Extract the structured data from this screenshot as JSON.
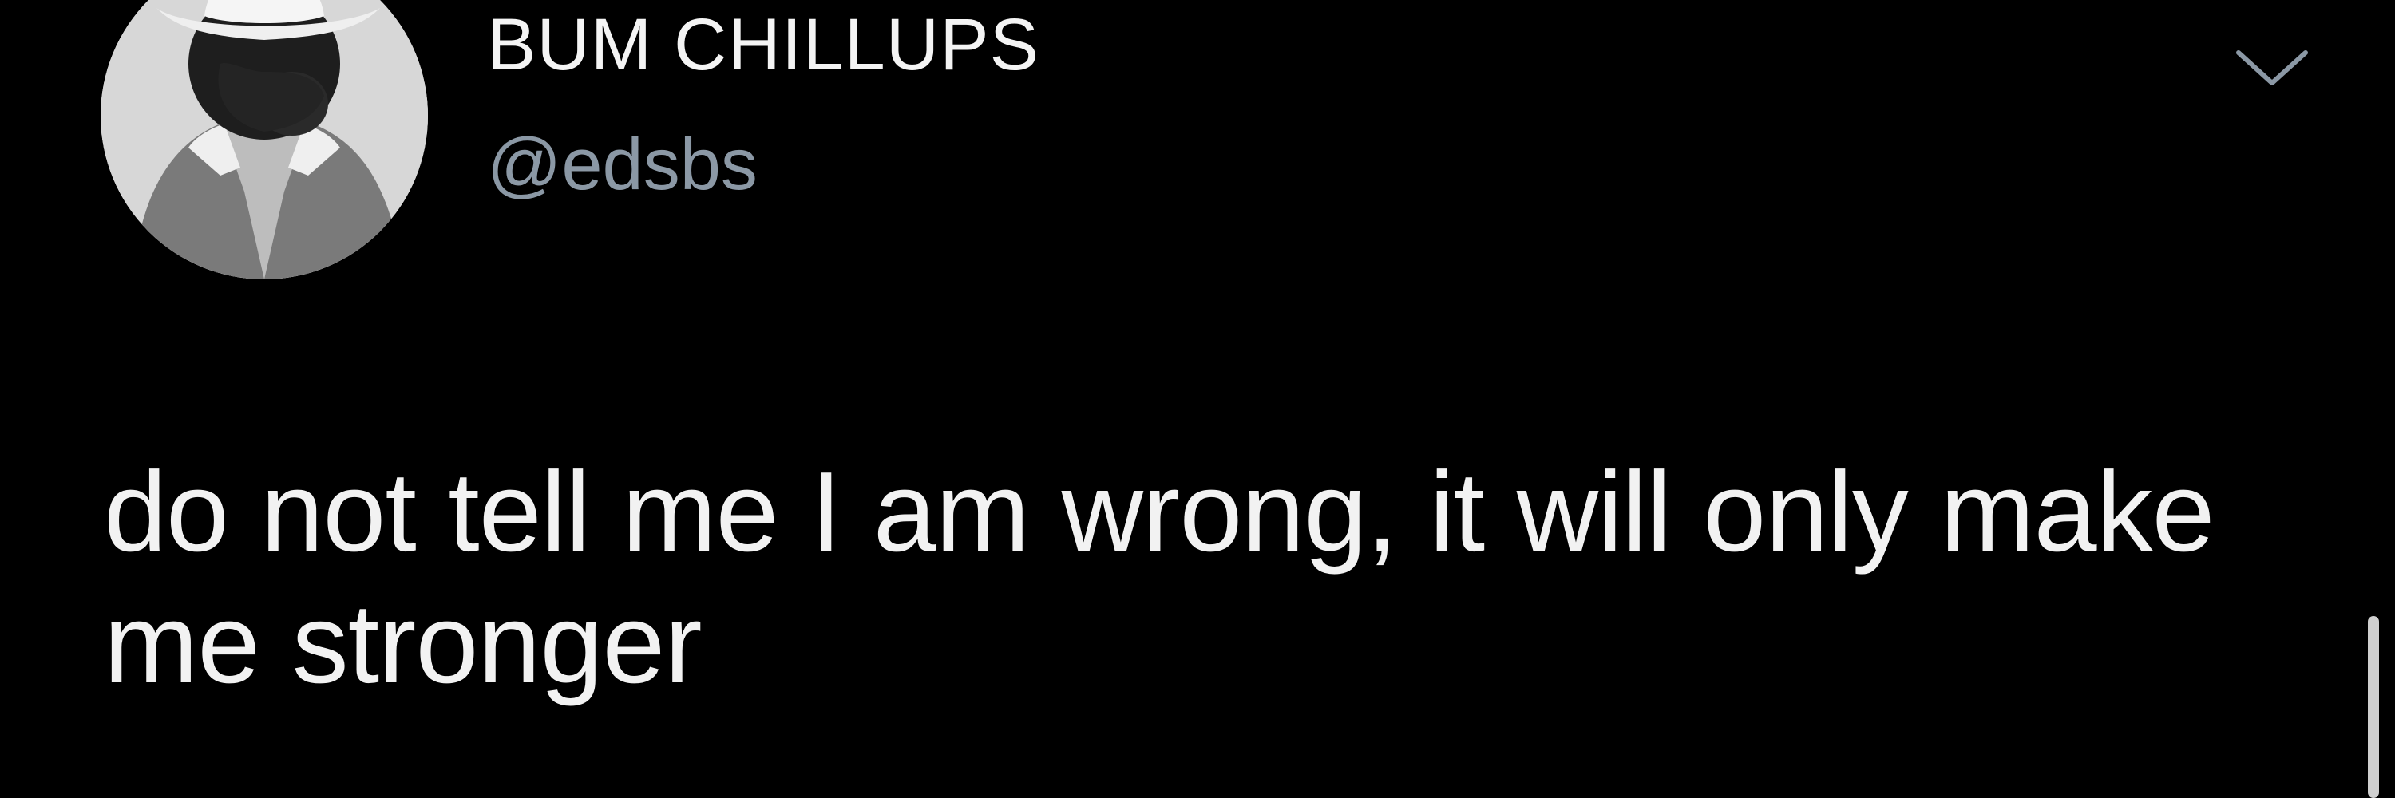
{
  "tweet": {
    "author": {
      "display_name": "BUM CHILLUPS",
      "handle": "@edsbs"
    },
    "text": "do not tell me I am wrong, it will only make me stronger",
    "icons": {
      "more": "chevron-down-icon"
    }
  },
  "colors": {
    "background": "#000000",
    "display_name": "#f4f4f4",
    "handle": "#8b98a5",
    "text": "#f2f2f2"
  }
}
